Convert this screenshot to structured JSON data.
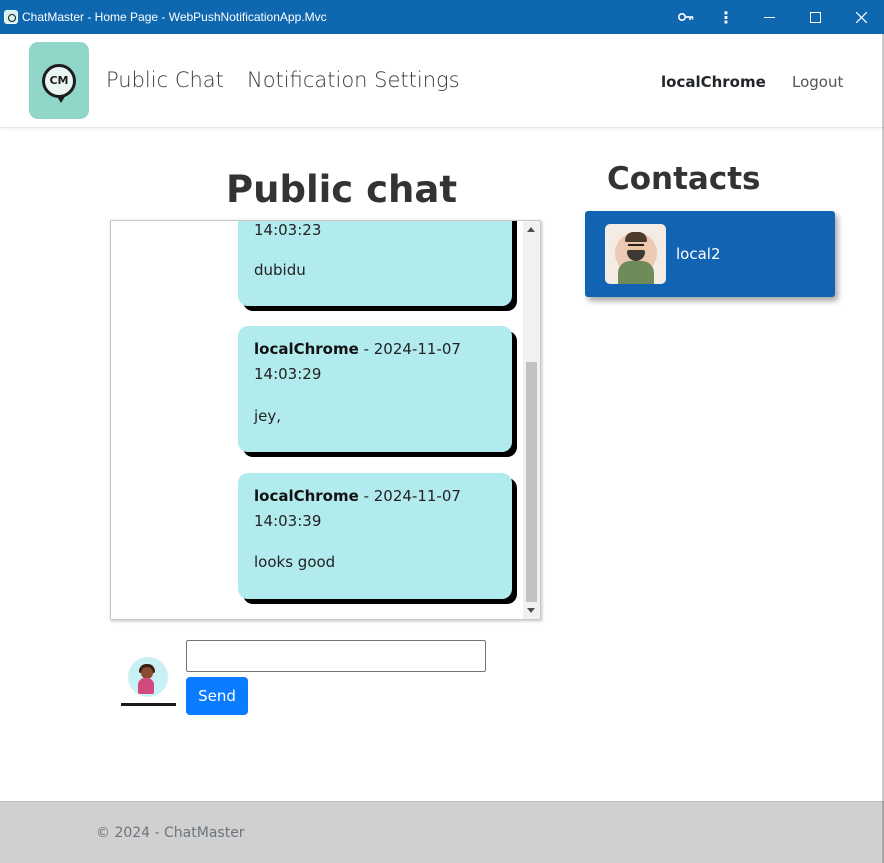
{
  "window": {
    "title": "ChatMaster - Home Page - WebPushNotificationApp.Mvc",
    "controls": {
      "key_icon": "key-icon",
      "menu_glyph": "⋮",
      "minimize_glyph": "—",
      "maximize_glyph": "☐",
      "close_glyph": "✕"
    }
  },
  "navbar": {
    "logo_text": "CM",
    "links": [
      {
        "label": "Public Chat"
      },
      {
        "label": "Notification Settings"
      }
    ],
    "username": "localChrome",
    "logout_label": "Logout"
  },
  "chat": {
    "heading": "Public chat",
    "messages": [
      {
        "author": "",
        "date": "",
        "time": "14:03:23",
        "text": "dubidu"
      },
      {
        "author": "localChrome",
        "date": "2024-11-07",
        "time": "14:03:29",
        "text": "jey,"
      },
      {
        "author": "localChrome",
        "date": "2024-11-07",
        "time": "14:03:39",
        "text": "looks good"
      }
    ],
    "scroll_position": 1.0
  },
  "composer": {
    "input_value": "",
    "send_label": "Send"
  },
  "contacts": {
    "heading": "Contacts",
    "items": [
      {
        "name": "local2"
      }
    ]
  },
  "footer": {
    "text": "© 2024 - ChatMaster"
  },
  "colors": {
    "titlebar": "#0f67b0",
    "message_bubble": "#b2ebee",
    "contact_card": "#1363b3",
    "send_button": "#0b7bff",
    "footer": "#d0d0d0"
  }
}
